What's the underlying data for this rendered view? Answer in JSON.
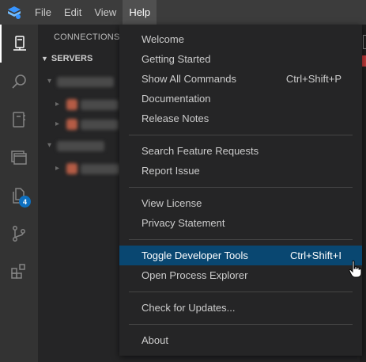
{
  "menubar": {
    "items": [
      {
        "label": "File"
      },
      {
        "label": "Edit"
      },
      {
        "label": "View"
      },
      {
        "label": "Help"
      }
    ]
  },
  "activity_bar": {
    "badge_count": "4",
    "icons": [
      "connections-icon",
      "search-icon",
      "notebook-icon",
      "windows-icon",
      "explorer-icon",
      "source-control-icon",
      "extensions-icon"
    ]
  },
  "sidebar": {
    "title": "CONNECTIONS",
    "section": "SERVERS"
  },
  "help_menu": {
    "welcome": "Welcome",
    "getting_started": "Getting Started",
    "show_all_commands": "Show All Commands",
    "show_all_commands_kb": "Ctrl+Shift+P",
    "documentation": "Documentation",
    "release_notes": "Release Notes",
    "search_feature_requests": "Search Feature Requests",
    "report_issue": "Report Issue",
    "view_license": "View License",
    "privacy_statement": "Privacy Statement",
    "toggle_dev_tools": "Toggle Developer Tools",
    "toggle_dev_tools_kb": "Ctrl+Shift+I",
    "open_process_explorer": "Open Process Explorer",
    "check_for_updates": "Check for Updates...",
    "about": "About"
  },
  "colors": {
    "menubar_bg": "#3c3c3c",
    "activity_bg": "#333333",
    "sidebar_bg": "#252526",
    "highlight": "#094771",
    "badge": "#0e70c0"
  }
}
